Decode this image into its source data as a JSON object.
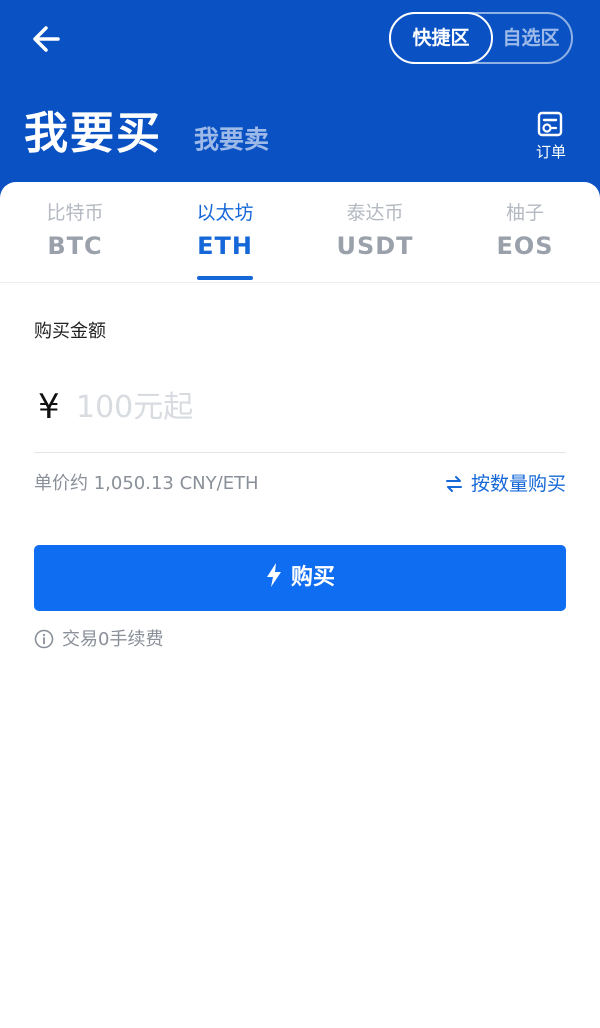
{
  "header": {
    "mode_toggle": {
      "quick": "快捷区",
      "custom": "自选区"
    },
    "title": "我要买",
    "sell_label": "我要卖",
    "orders_label": "订单"
  },
  "tabs": [
    {
      "cn": "比特币",
      "code": "BTC"
    },
    {
      "cn": "以太坊",
      "code": "ETH"
    },
    {
      "cn": "泰达币",
      "code": "USDT"
    },
    {
      "cn": "柚子",
      "code": "EOS"
    }
  ],
  "active_tab": "ETH",
  "form": {
    "amount_label": "购买金额",
    "currency_symbol": "¥",
    "placeholder": "100元起",
    "unit_price": "单价约 1,050.13 CNY/ETH",
    "switch_mode": "按数量购买",
    "buy_button": "购买",
    "fee_note": "交易0手续费"
  },
  "colors": {
    "header_bg": "#0a52c4",
    "accent": "#1668d8",
    "button_bg": "#0f6df2"
  },
  "icons": [
    "back-arrow-icon",
    "orders-icon",
    "swap-icon",
    "lightning-icon",
    "info-icon"
  ]
}
